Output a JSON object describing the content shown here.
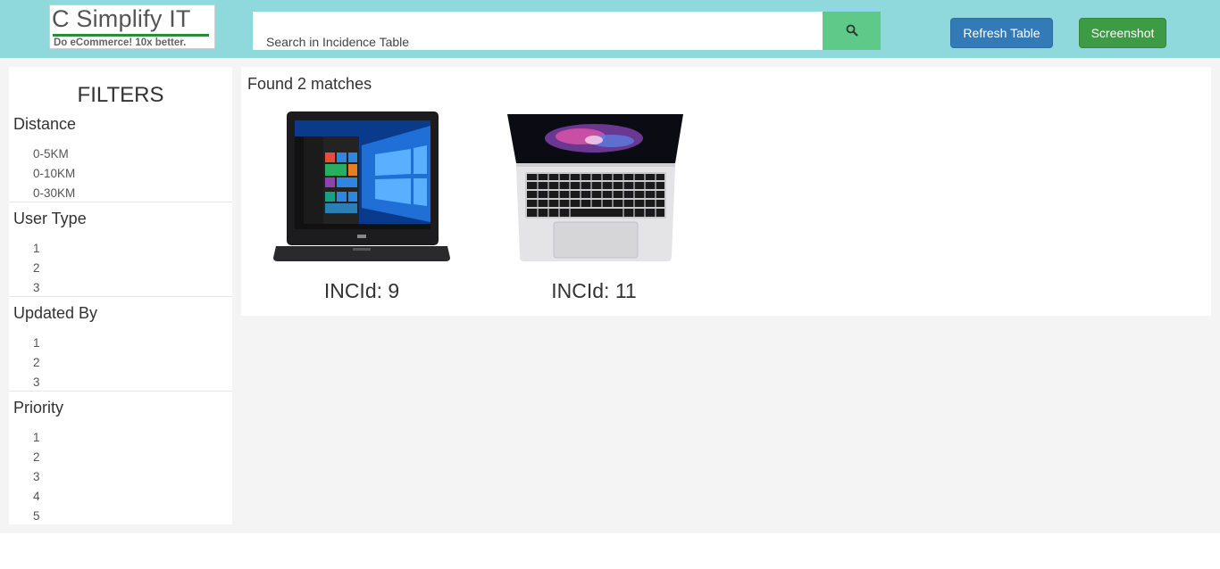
{
  "header": {
    "logo": {
      "title": "C Simplify IT",
      "tagline": "Do eCommerce! 10x better."
    },
    "search": {
      "placeholder": "Search in Incidence Table",
      "button_icon": "search-icon"
    },
    "refresh_label": "Refresh Table",
    "screenshot_label": "Screenshot"
  },
  "sidebar": {
    "title": "FILTERS",
    "groups": [
      {
        "heading": "Distance",
        "options": [
          "0-5KM",
          "0-10KM",
          "0-30KM"
        ]
      },
      {
        "heading": "User Type",
        "options": [
          "1",
          "2",
          "3"
        ]
      },
      {
        "heading": "Updated By",
        "options": [
          "1",
          "2",
          "3"
        ]
      },
      {
        "heading": "Priority",
        "options": [
          "1",
          "2",
          "3",
          "4",
          "5"
        ]
      }
    ]
  },
  "results": {
    "summary": "Found 2 matches",
    "items": [
      {
        "label": "INCId: 9",
        "image": "dell-laptop-windows"
      },
      {
        "label": "INCId: 11",
        "image": "macbook-laptop"
      }
    ]
  },
  "colors": {
    "header_bg": "#8fd8dc",
    "search_button": "#5fc98a",
    "refresh_button": "#337ab7",
    "screenshot_button": "#3d9a45",
    "page_bg": "#f4f4f4"
  }
}
